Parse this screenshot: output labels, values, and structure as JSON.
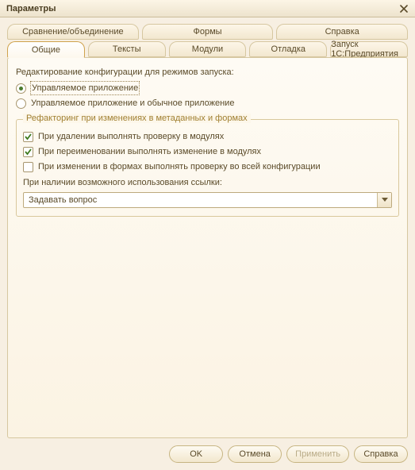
{
  "window": {
    "title": "Параметры"
  },
  "tabs_row1": [
    {
      "label": "Сравнение/объединение"
    },
    {
      "label": "Формы"
    },
    {
      "label": "Справка"
    }
  ],
  "tabs_row2": [
    {
      "label": "Общие",
      "active": true
    },
    {
      "label": "Тексты"
    },
    {
      "label": "Модули"
    },
    {
      "label": "Отладка"
    },
    {
      "label": "Запуск 1С:Предприятия"
    }
  ],
  "page": {
    "edit_modes_label": "Редактирование конфигурации для режимов запуска:",
    "radio": {
      "managed": "Управляемое приложение",
      "both": "Управляемое приложение и обычное приложение",
      "selected": "managed"
    },
    "group": {
      "legend": "Рефакторинг при изменениях в метаданных и формах",
      "check_delete": {
        "label": "При удалении выполнять проверку в модулях",
        "checked": true
      },
      "check_rename": {
        "label": "При переименовании выполнять изменение в модулях",
        "checked": true
      },
      "check_forms": {
        "label": "При изменении в формах выполнять проверку во всей конфигурации",
        "checked": false
      },
      "on_ref_label": "При наличии возможного использования ссылки:",
      "select_value": "Задавать вопрос"
    }
  },
  "buttons": {
    "ok": "OK",
    "cancel": "Отмена",
    "apply": "Применить",
    "help": "Справка"
  }
}
